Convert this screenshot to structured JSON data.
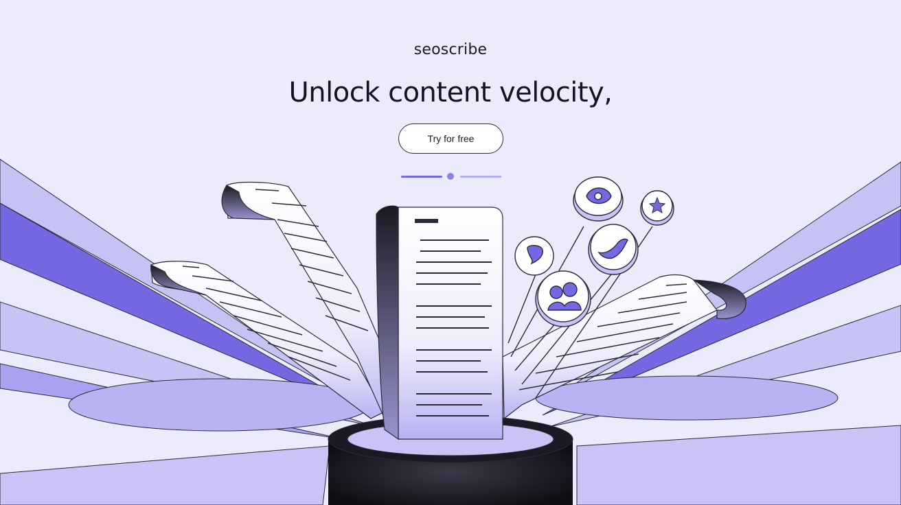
{
  "brand": {
    "name": "seoscribe"
  },
  "hero": {
    "headline": "Unlock content velocity,",
    "cta_label": "Try for free"
  },
  "carousel": {
    "slide_count": 2,
    "active_index": 0
  },
  "icons": [
    {
      "name": "chat-bubble-icon"
    },
    {
      "name": "shield-icon"
    },
    {
      "name": "bird-icon"
    },
    {
      "name": "star-icon"
    },
    {
      "name": "users-icon"
    }
  ],
  "colors": {
    "background": "#ecebfb",
    "accent": "#7468e2",
    "accent_light": "#c9c5f5",
    "ink": "#14141c"
  }
}
